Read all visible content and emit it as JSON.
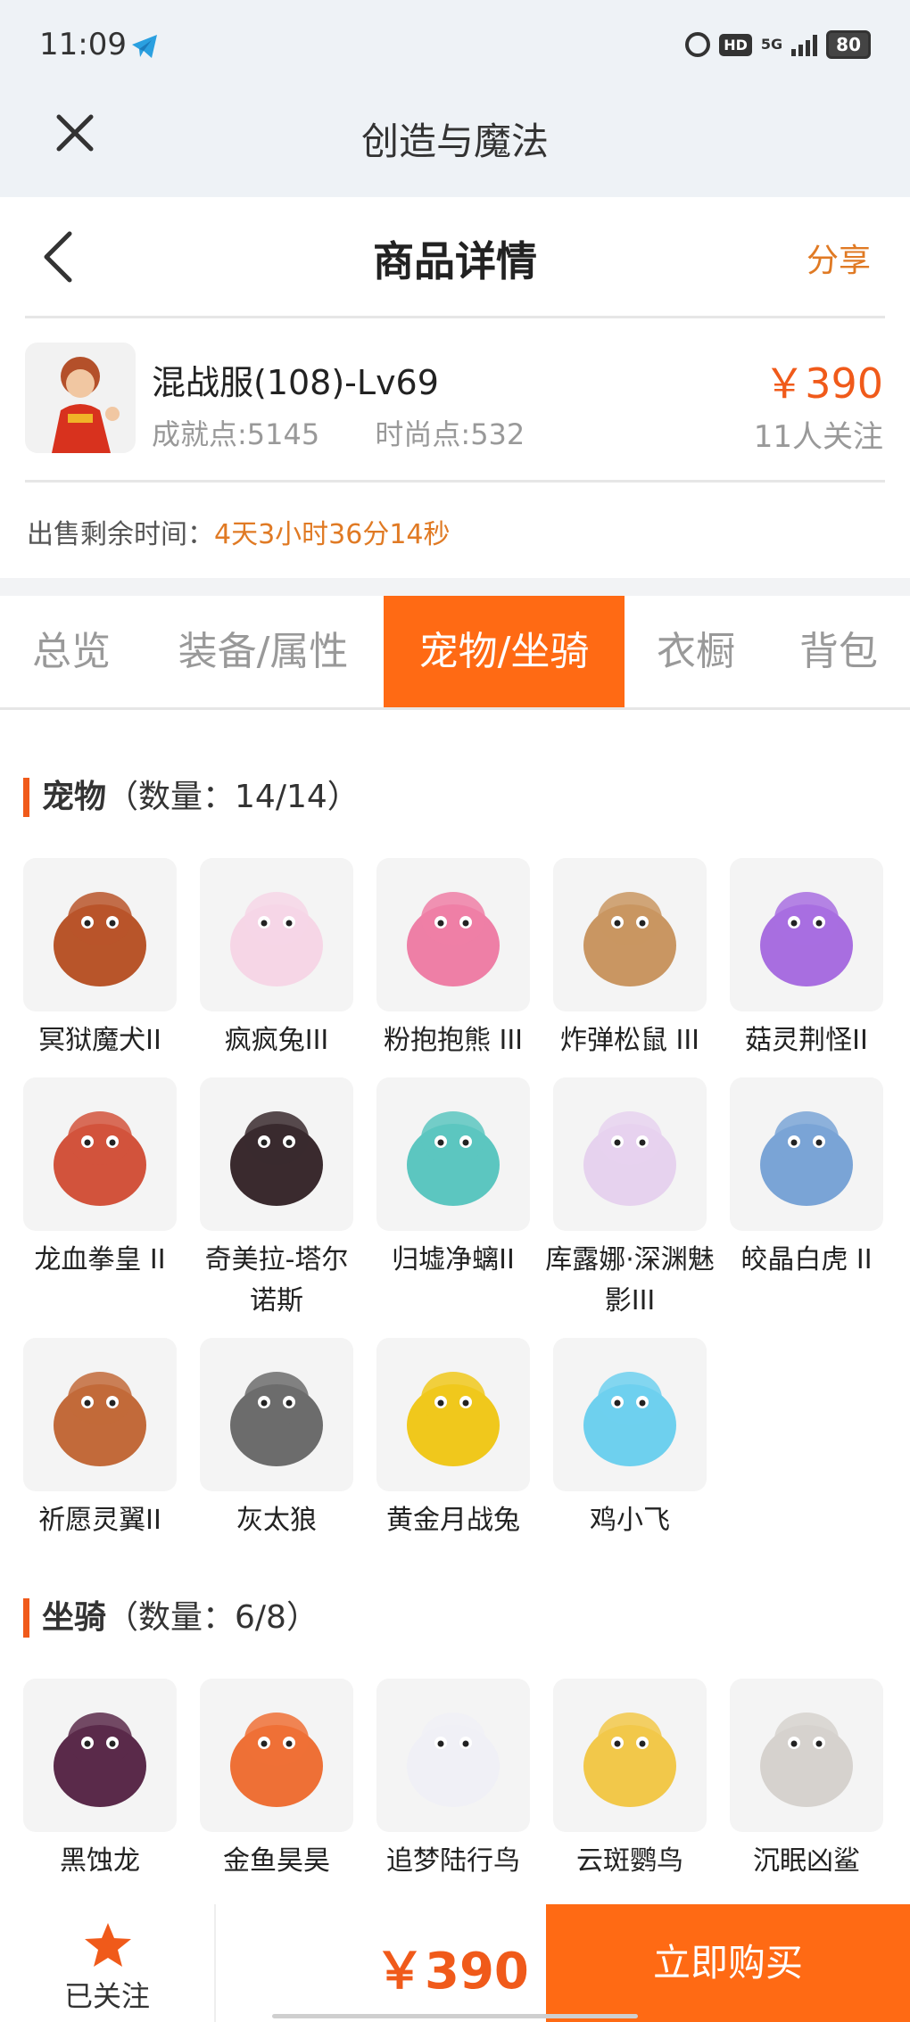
{
  "status_bar": {
    "time": "11:09",
    "network": "5G",
    "battery": "80",
    "hd": "HD"
  },
  "app_bar": {
    "title": "创造与魔法"
  },
  "page_header": {
    "title": "商品详情",
    "share_label": "分享"
  },
  "product": {
    "name": "混战服(108)-Lv69",
    "achievement": "成就点:5145",
    "fashion": "时尚点:532",
    "price": "￥390",
    "followers": "11人关注"
  },
  "remaining": {
    "label": "出售剩余时间：",
    "value": "4天3小时36分14秒"
  },
  "tabs": [
    {
      "label": "总览",
      "active": false
    },
    {
      "label": "装备/属性",
      "active": false
    },
    {
      "label": "宠物/坐骑",
      "active": true
    },
    {
      "label": "衣橱",
      "active": false
    },
    {
      "label": "背包",
      "active": false
    }
  ],
  "pets": {
    "title": "宠物",
    "count": "（数量：14/14）",
    "items": [
      {
        "name": "冥狱魔犬II",
        "color": "#b8552a"
      },
      {
        "name": "疯疯兔III",
        "color": "#f6d6e6"
      },
      {
        "name": "粉抱抱熊 III",
        "color": "#ee7fa6"
      },
      {
        "name": "炸弹松鼠 III",
        "color": "#c99662"
      },
      {
        "name": "菇灵荆怪II",
        "color": "#a86ee0"
      },
      {
        "name": "龙血拳皇 II",
        "color": "#d2533c"
      },
      {
        "name": "奇美拉-塔尔诺斯",
        "color": "#3a2a2e"
      },
      {
        "name": "归墟净螭II",
        "color": "#5cc6c0"
      },
      {
        "name": "库露娜·深渊魅影III",
        "color": "#e6d2ee"
      },
      {
        "name": "皎晶白虎 II",
        "color": "#7aa4d6"
      },
      {
        "name": "祈愿灵翼II",
        "color": "#c26a3a"
      },
      {
        "name": "灰太狼",
        "color": "#6c6c6c"
      },
      {
        "name": "黄金月战兔",
        "color": "#f0c81c"
      },
      {
        "name": "鸡小飞",
        "color": "#6ed0ee"
      }
    ]
  },
  "mounts": {
    "title": "坐骑",
    "count": "（数量：6/8）",
    "items": [
      {
        "name": "黑蚀龙",
        "color": "#5a2a4a"
      },
      {
        "name": "金鱼昊昊",
        "color": "#ee7036"
      },
      {
        "name": "追梦陆行鸟",
        "color": "#f0f0f6"
      },
      {
        "name": "云斑鹦鸟",
        "color": "#f2c84a"
      },
      {
        "name": "沉眠凶鲨",
        "color": "#d6d2ce"
      }
    ]
  },
  "bottom_bar": {
    "follow_label": "已关注",
    "total_price": "￥390",
    "buy_label": "立即购买"
  },
  "colors": {
    "accent": "#ff6a14",
    "price": "#f05a1a",
    "highlight": "#e07a24"
  }
}
